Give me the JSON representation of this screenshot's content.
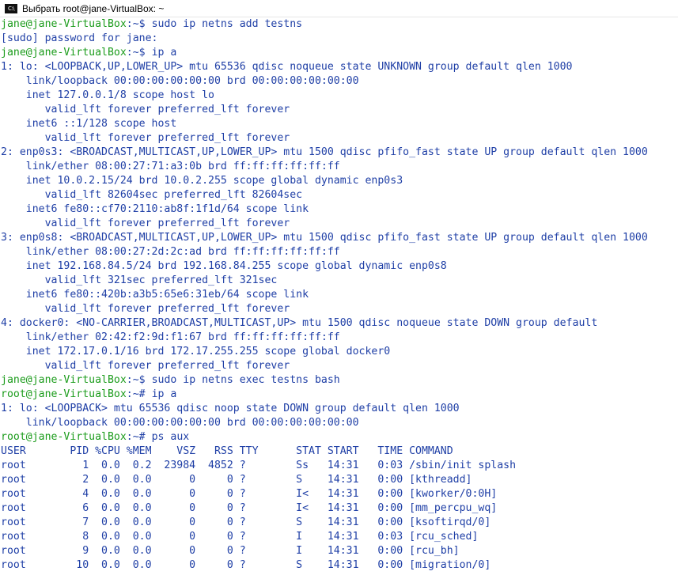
{
  "window": {
    "title": "Выбрать root@jane-VirtualBox: ~",
    "icon_name": "console-icon",
    "icon_text": "C:\\"
  },
  "colors": {
    "prompt_user": "#1c9c1c",
    "text": "#1f3fa6",
    "background": "#ffffff"
  },
  "terminal": {
    "lines": [
      {
        "type": "prompt",
        "user": "jane@jane-VirtualBox",
        "path": ":~$ ",
        "cmd": "sudo ip netns add testns"
      },
      {
        "type": "out",
        "text": "[sudo] password for jane:"
      },
      {
        "type": "prompt",
        "user": "jane@jane-VirtualBox",
        "path": ":~$ ",
        "cmd": "ip a"
      },
      {
        "type": "out",
        "text": "1: lo: <LOOPBACK,UP,LOWER_UP> mtu 65536 qdisc noqueue state UNKNOWN group default qlen 1000"
      },
      {
        "type": "out",
        "text": "    link/loopback 00:00:00:00:00:00 brd 00:00:00:00:00:00"
      },
      {
        "type": "out",
        "text": "    inet 127.0.0.1/8 scope host lo"
      },
      {
        "type": "out",
        "text": "       valid_lft forever preferred_lft forever"
      },
      {
        "type": "out",
        "text": "    inet6 ::1/128 scope host"
      },
      {
        "type": "out",
        "text": "       valid_lft forever preferred_lft forever"
      },
      {
        "type": "out",
        "text": "2: enp0s3: <BROADCAST,MULTICAST,UP,LOWER_UP> mtu 1500 qdisc pfifo_fast state UP group default qlen 1000"
      },
      {
        "type": "out",
        "text": "    link/ether 08:00:27:71:a3:0b brd ff:ff:ff:ff:ff:ff"
      },
      {
        "type": "out",
        "text": "    inet 10.0.2.15/24 brd 10.0.2.255 scope global dynamic enp0s3"
      },
      {
        "type": "out",
        "text": "       valid_lft 82604sec preferred_lft 82604sec"
      },
      {
        "type": "out",
        "text": "    inet6 fe80::cf70:2110:ab8f:1f1d/64 scope link"
      },
      {
        "type": "out",
        "text": "       valid_lft forever preferred_lft forever"
      },
      {
        "type": "out",
        "text": "3: enp0s8: <BROADCAST,MULTICAST,UP,LOWER_UP> mtu 1500 qdisc pfifo_fast state UP group default qlen 1000"
      },
      {
        "type": "out",
        "text": "    link/ether 08:00:27:2d:2c:ad brd ff:ff:ff:ff:ff:ff"
      },
      {
        "type": "out",
        "text": "    inet 192.168.84.5/24 brd 192.168.84.255 scope global dynamic enp0s8"
      },
      {
        "type": "out",
        "text": "       valid_lft 321sec preferred_lft 321sec"
      },
      {
        "type": "out",
        "text": "    inet6 fe80::420b:a3b5:65e6:31eb/64 scope link"
      },
      {
        "type": "out",
        "text": "       valid_lft forever preferred_lft forever"
      },
      {
        "type": "out",
        "text": "4: docker0: <NO-CARRIER,BROADCAST,MULTICAST,UP> mtu 1500 qdisc noqueue state DOWN group default"
      },
      {
        "type": "out",
        "text": "    link/ether 02:42:f2:9d:f1:67 brd ff:ff:ff:ff:ff:ff"
      },
      {
        "type": "out",
        "text": "    inet 172.17.0.1/16 brd 172.17.255.255 scope global docker0"
      },
      {
        "type": "out",
        "text": "       valid_lft forever preferred_lft forever"
      },
      {
        "type": "prompt",
        "user": "jane@jane-VirtualBox",
        "path": ":~$ ",
        "cmd": "sudo ip netns exec testns bash"
      },
      {
        "type": "prompt",
        "user": "root@jane-VirtualBox",
        "path": ":~# ",
        "cmd": "ip a"
      },
      {
        "type": "out",
        "text": "1: lo: <LOOPBACK> mtu 65536 qdisc noop state DOWN group default qlen 1000"
      },
      {
        "type": "out",
        "text": "    link/loopback 00:00:00:00:00:00 brd 00:00:00:00:00:00"
      },
      {
        "type": "prompt",
        "user": "root@jane-VirtualBox",
        "path": ":~# ",
        "cmd": "ps aux"
      },
      {
        "type": "out",
        "text": "USER       PID %CPU %MEM    VSZ   RSS TTY      STAT START   TIME COMMAND"
      },
      {
        "type": "out",
        "text": "root         1  0.0  0.2  23984  4852 ?        Ss   14:31   0:03 /sbin/init splash"
      },
      {
        "type": "out",
        "text": "root         2  0.0  0.0      0     0 ?        S    14:31   0:00 [kthreadd]"
      },
      {
        "type": "out",
        "text": "root         4  0.0  0.0      0     0 ?        I<   14:31   0:00 [kworker/0:0H]"
      },
      {
        "type": "out",
        "text": "root         6  0.0  0.0      0     0 ?        I<   14:31   0:00 [mm_percpu_wq]"
      },
      {
        "type": "out",
        "text": "root         7  0.0  0.0      0     0 ?        S    14:31   0:00 [ksoftirqd/0]"
      },
      {
        "type": "out",
        "text": "root         8  0.0  0.0      0     0 ?        I    14:31   0:03 [rcu_sched]"
      },
      {
        "type": "out",
        "text": "root         9  0.0  0.0      0     0 ?        I    14:31   0:00 [rcu_bh]"
      },
      {
        "type": "out",
        "text": "root        10  0.0  0.0      0     0 ?        S    14:31   0:00 [migration/0]"
      }
    ]
  }
}
